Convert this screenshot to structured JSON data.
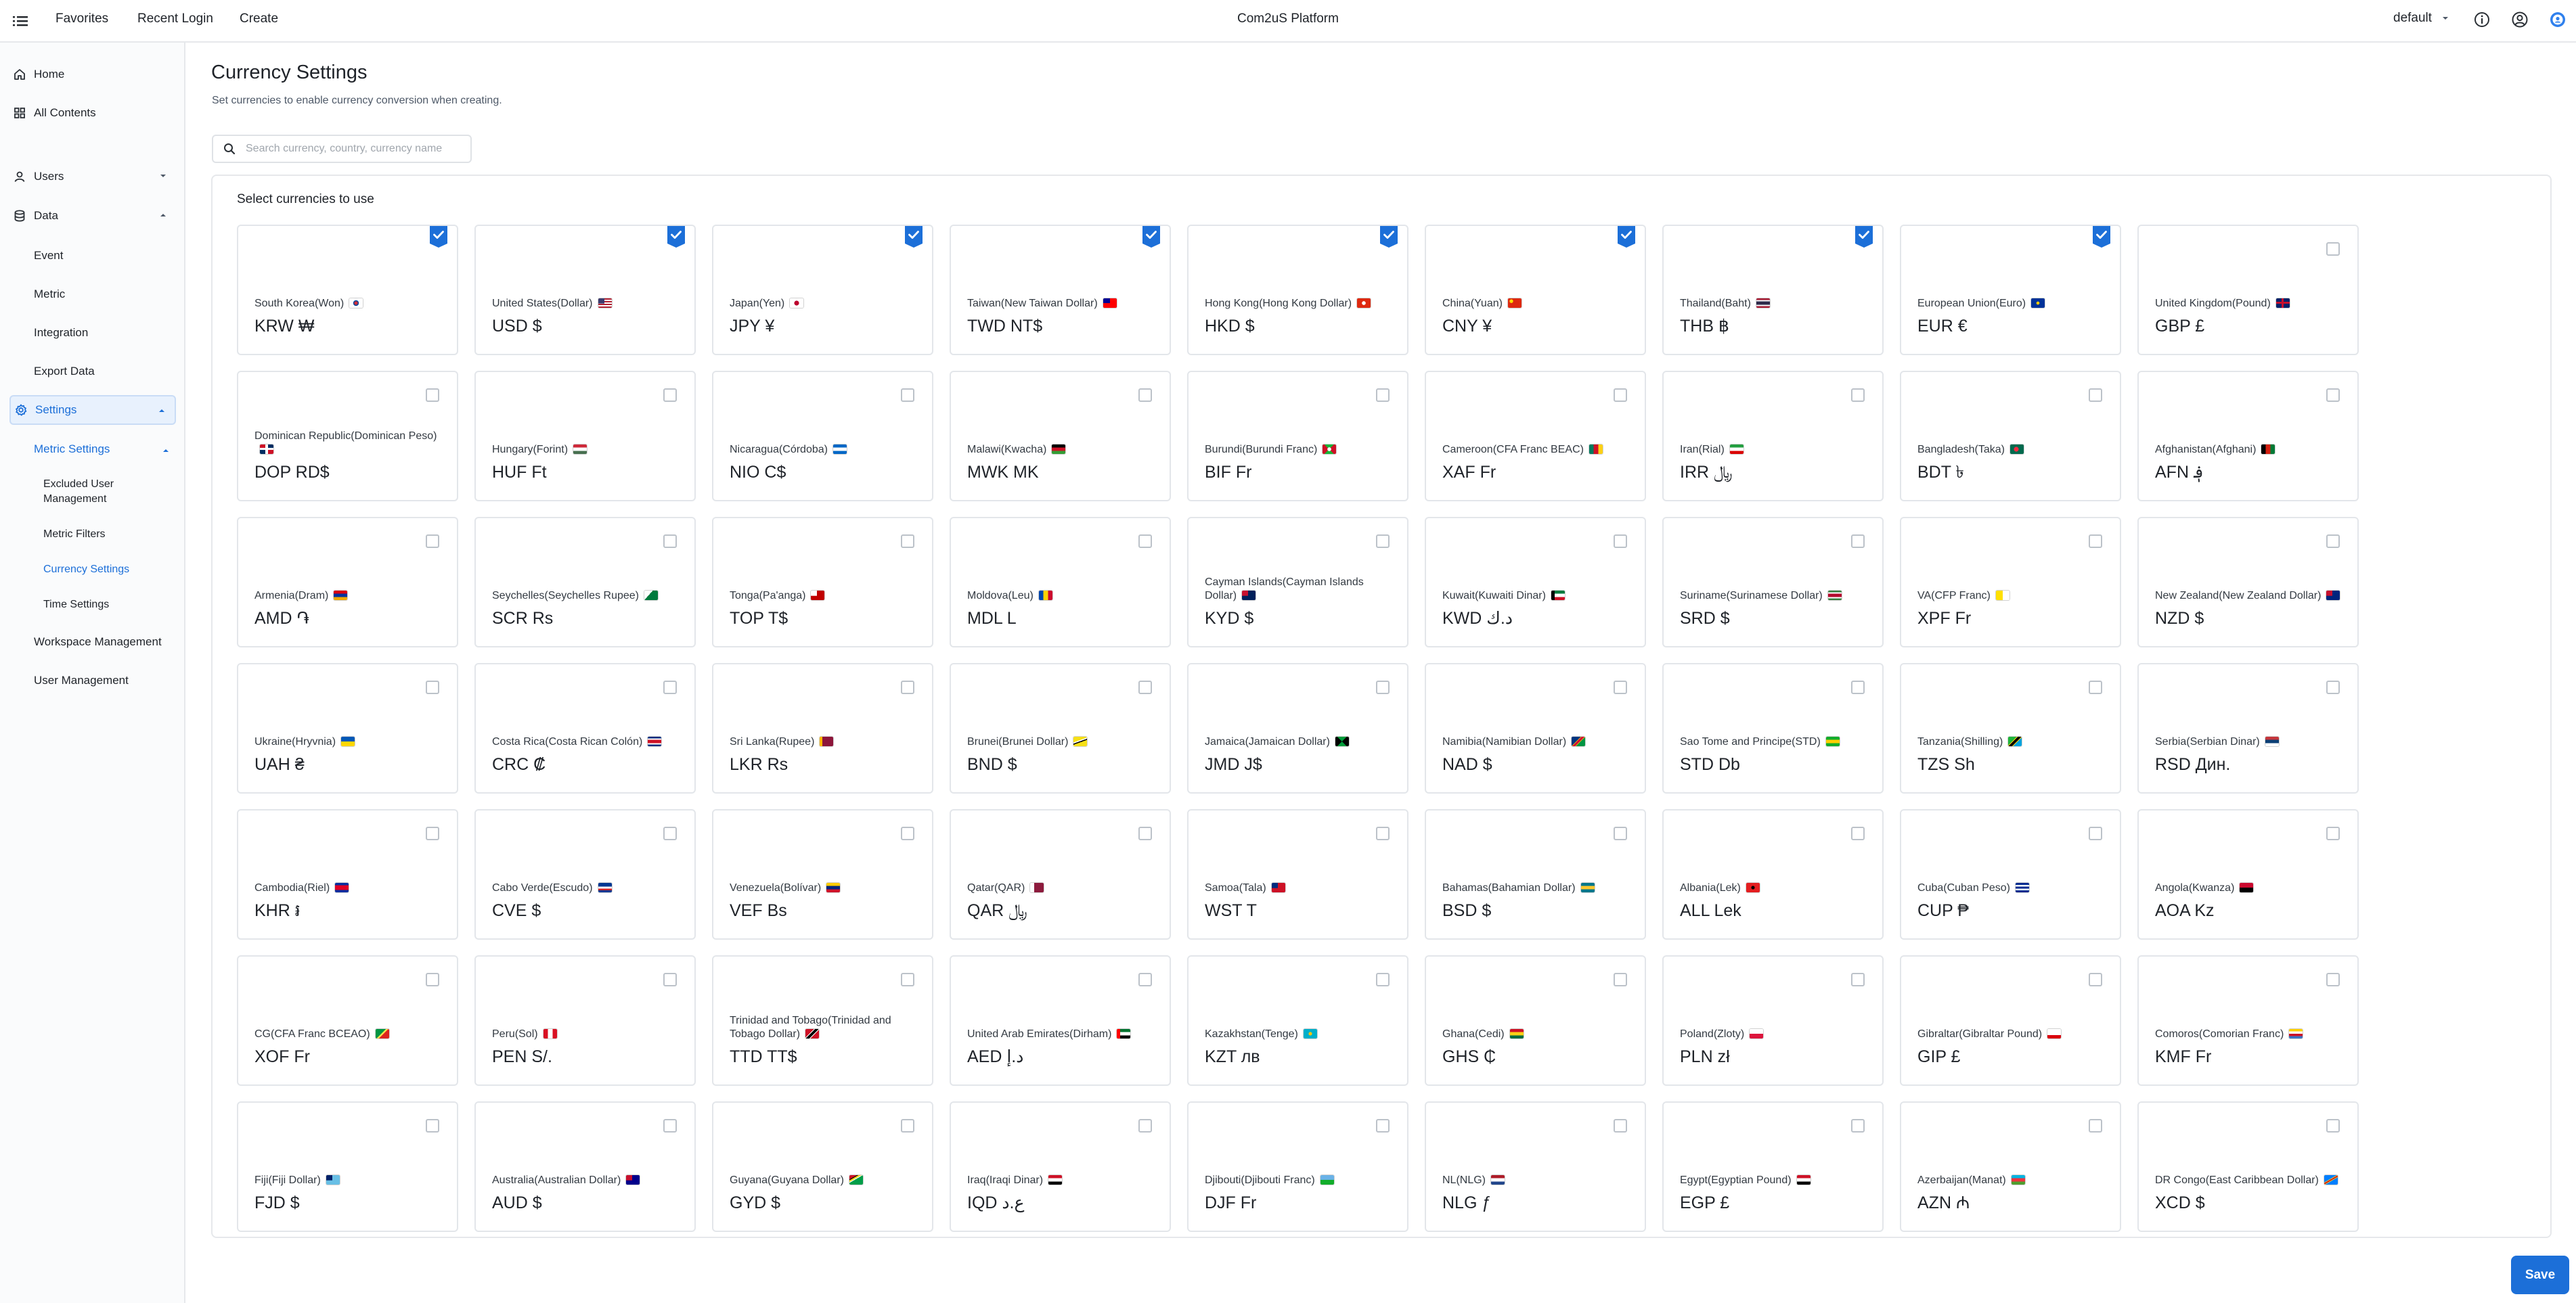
{
  "topbar": {
    "favorites": "Favorites",
    "recent_login": "Recent Login",
    "create": "Create",
    "title": "Com2uS Platform",
    "workspace": "default",
    "icons": [
      "menu-icon",
      "chevron-down-icon",
      "info-icon",
      "user-circle-icon",
      "avatar-icon"
    ]
  },
  "sidebar": {
    "home": "Home",
    "all_contents": "All Contents",
    "users": "Users",
    "data": "Data",
    "event": "Event",
    "metric": "Metric",
    "integration": "Integration",
    "export_data": "Export Data",
    "settings": "Settings",
    "metric_settings": "Metric Settings",
    "excluded_user_management": "Excluded User Management",
    "metric_filters": "Metric Filters",
    "currency_settings": "Currency Settings",
    "time_settings": "Time Settings",
    "workspace_management": "Workspace Management",
    "user_management": "User Management"
  },
  "main": {
    "title": "Currency Settings",
    "description": "Set currencies to enable currency conversion when creating.",
    "search_placeholder": "Search currency, country, currency name",
    "panel_title": "Select currencies to use",
    "save": "Save"
  },
  "colors": {
    "accent": "#1c6fd8",
    "accent_bg": "#e8f1fd",
    "border": "#e3e6ea"
  },
  "currencies": [
    {
      "country": "South Korea(Won)",
      "code": "KRW ₩",
      "checked": true
    },
    {
      "country": "United States(Dollar)",
      "code": "USD $",
      "checked": true
    },
    {
      "country": "Japan(Yen)",
      "code": "JPY ¥",
      "checked": true
    },
    {
      "country": "Taiwan(New Taiwan Dollar)",
      "code": "TWD NT$",
      "checked": true
    },
    {
      "country": "Hong Kong(Hong Kong Dollar)",
      "code": "HKD $",
      "checked": true
    },
    {
      "country": "China(Yuan)",
      "code": "CNY ¥",
      "checked": true
    },
    {
      "country": "Thailand(Baht)",
      "code": "THB ฿",
      "checked": true
    },
    {
      "country": "European Union(Euro)",
      "code": "EUR €",
      "checked": true
    },
    {
      "country": "United Kingdom(Pound)",
      "code": "GBP £",
      "checked": false
    },
    {
      "country": "Dominican Republic(Dominican Peso)",
      "code": "DOP RD$",
      "checked": false
    },
    {
      "country": "Hungary(Forint)",
      "code": "HUF Ft",
      "checked": false
    },
    {
      "country": "Nicaragua(Córdoba)",
      "code": "NIO C$",
      "checked": false
    },
    {
      "country": "Malawi(Kwacha)",
      "code": "MWK MK",
      "checked": false
    },
    {
      "country": "Burundi(Burundi Franc)",
      "code": "BIF Fr",
      "checked": false
    },
    {
      "country": "Cameroon(CFA Franc BEAC)",
      "code": "XAF Fr",
      "checked": false
    },
    {
      "country": "Iran(Rial)",
      "code": "IRR ﷼",
      "checked": false
    },
    {
      "country": "Bangladesh(Taka)",
      "code": "BDT ৳",
      "checked": false
    },
    {
      "country": "Afghanistan(Afghani)",
      "code": "AFN ؋",
      "checked": false
    },
    {
      "country": "Armenia(Dram)",
      "code": "AMD ֏",
      "checked": false
    },
    {
      "country": "Seychelles(Seychelles Rupee)",
      "code": "SCR Rs",
      "checked": false
    },
    {
      "country": "Tonga(Pa'anga)",
      "code": "TOP T$",
      "checked": false
    },
    {
      "country": "Moldova(Leu)",
      "code": "MDL L",
      "checked": false
    },
    {
      "country": "Cayman Islands(Cayman Islands Dollar)",
      "code": "KYD $",
      "checked": false
    },
    {
      "country": "Kuwait(Kuwaiti Dinar)",
      "code": "KWD د.ك",
      "checked": false
    },
    {
      "country": "Suriname(Surinamese Dollar)",
      "code": "SRD $",
      "checked": false
    },
    {
      "country": "VA(CFP Franc)",
      "code": "XPF Fr",
      "checked": false
    },
    {
      "country": "New Zealand(New Zealand Dollar)",
      "code": "NZD $",
      "checked": false
    },
    {
      "country": "Ukraine(Hryvnia)",
      "code": "UAH ₴",
      "checked": false
    },
    {
      "country": "Costa Rica(Costa Rican Colón)",
      "code": "CRC ₡",
      "checked": false
    },
    {
      "country": "Sri Lanka(Rupee)",
      "code": "LKR Rs",
      "checked": false
    },
    {
      "country": "Brunei(Brunei Dollar)",
      "code": "BND $",
      "checked": false
    },
    {
      "country": "Jamaica(Jamaican Dollar)",
      "code": "JMD J$",
      "checked": false
    },
    {
      "country": "Namibia(Namibian Dollar)",
      "code": "NAD $",
      "checked": false
    },
    {
      "country": "Sao Tome and Principe(STD)",
      "code": "STD Db",
      "checked": false
    },
    {
      "country": "Tanzania(Shilling)",
      "code": "TZS Sh",
      "checked": false
    },
    {
      "country": "Serbia(Serbian Dinar)",
      "code": "RSD Дин.",
      "checked": false
    },
    {
      "country": "Cambodia(Riel)",
      "code": "KHR ៛",
      "checked": false
    },
    {
      "country": "Cabo Verde(Escudo)",
      "code": "CVE $",
      "checked": false
    },
    {
      "country": "Venezuela(Bolívar)",
      "code": "VEF Bs",
      "checked": false
    },
    {
      "country": "Qatar(QAR)",
      "code": "QAR ﷼",
      "checked": false
    },
    {
      "country": "Samoa(Tala)",
      "code": "WST T",
      "checked": false
    },
    {
      "country": "Bahamas(Bahamian Dollar)",
      "code": "BSD $",
      "checked": false
    },
    {
      "country": "Albania(Lek)",
      "code": "ALL Lek",
      "checked": false
    },
    {
      "country": "Cuba(Cuban Peso)",
      "code": "CUP ₱",
      "checked": false
    },
    {
      "country": "Angola(Kwanza)",
      "code": "AOA Kz",
      "checked": false
    },
    {
      "country": "CG(CFA Franc BCEAO)",
      "code": "XOF Fr",
      "checked": false
    },
    {
      "country": "Peru(Sol)",
      "code": "PEN S/.",
      "checked": false
    },
    {
      "country": "Trinidad and Tobago(Trinidad and Tobago Dollar)",
      "code": "TTD TT$",
      "checked": false
    },
    {
      "country": "United Arab Emirates(Dirham)",
      "code": "AED د.إ",
      "checked": false
    },
    {
      "country": "Kazakhstan(Tenge)",
      "code": "KZT лв",
      "checked": false
    },
    {
      "country": "Ghana(Cedi)",
      "code": "GHS ₵",
      "checked": false
    },
    {
      "country": "Poland(Zloty)",
      "code": "PLN zł",
      "checked": false
    },
    {
      "country": "Gibraltar(Gibraltar Pound)",
      "code": "GIP £",
      "checked": false
    },
    {
      "country": "Comoros(Comorian Franc)",
      "code": "KMF Fr",
      "checked": false
    },
    {
      "country": "Fiji(Fiji Dollar)",
      "code": "FJD $",
      "checked": false
    },
    {
      "country": "Australia(Australian Dollar)",
      "code": "AUD $",
      "checked": false
    },
    {
      "country": "Guyana(Guyana Dollar)",
      "code": "GYD $",
      "checked": false
    },
    {
      "country": "Iraq(Iraqi Dinar)",
      "code": "IQD ع.د",
      "checked": false
    },
    {
      "country": "Djibouti(Djibouti Franc)",
      "code": "DJF Fr",
      "checked": false
    },
    {
      "country": "NL(NLG)",
      "code": "NLG ƒ",
      "checked": false
    },
    {
      "country": "Egypt(Egyptian Pound)",
      "code": "EGP £",
      "checked": false
    },
    {
      "country": "Azerbaijan(Manat)",
      "code": "AZN ₼",
      "checked": false
    },
    {
      "country": "DR Congo(East Caribbean Dollar)",
      "code": "XCD $",
      "checked": false
    }
  ]
}
